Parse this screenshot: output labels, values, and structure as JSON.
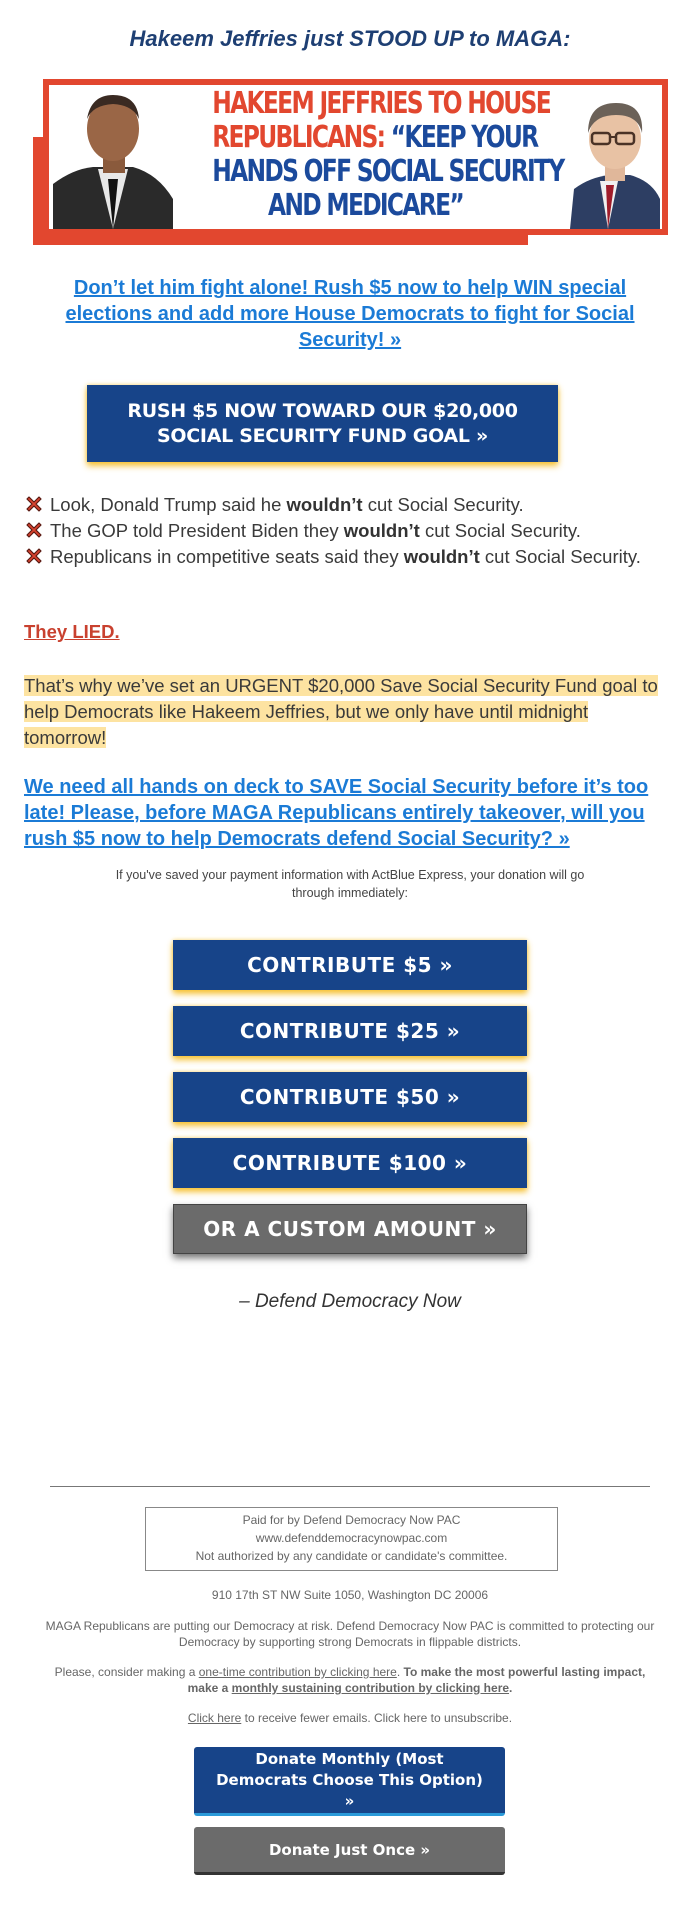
{
  "headline": "Hakeem Jeffries just STOOD UP to MAGA:",
  "banner": {
    "line1": "HAKEEM JEFFRIES TO HOUSE",
    "line2_red": "REPUBLICANS: ",
    "line2_blue": "“KEEP YOUR",
    "line3": "HANDS OFF SOCIAL SECURITY",
    "line4": "AND MEDICARE”",
    "left_photo": "hakeem-jeffries-photo",
    "right_photo": "mike-johnson-photo",
    "colors": {
      "red": "#e2472f",
      "blue": "#1b4a9c"
    }
  },
  "lead_link": "Don’t let him fight alone! Rush $5 now to help WIN special elections and add more House Democrats to fight for Social Security! »",
  "goal_button": "RUSH $5 NOW TOWARD OUR $20,000 SOCIAL SECURITY FUND GOAL »",
  "bullets": [
    {
      "icon": "x-mark-icon",
      "before": "Look, Donald Trump said he ",
      "bold": "wouldn’t",
      "after": " cut Social Security."
    },
    {
      "icon": "x-mark-icon",
      "before": "The GOP told President Biden they ",
      "bold": "wouldn’t",
      "after": " cut Social Security."
    },
    {
      "icon": "x-mark-icon",
      "before": "Republicans in competitive seats said they ",
      "bold": "wouldn’t",
      "after": " cut Social Security."
    }
  ],
  "lied": "They LIED.",
  "urgent_text": "That’s why we’ve set an URGENT $20,000 Save Social Security Fund goal to help Democrats like Hakeem Jeffries, but we only have until midnight tomorrow!",
  "main_link": "We need all hands on deck to SAVE Social Security before it’s too late! Please, before MAGA Republicans entirely takeover, will you rush $5 now to help Democrats defend Social Security? »",
  "express_note": "If you've saved your payment information with ActBlue Express, your donation will go through immediately:",
  "contribute_buttons": [
    {
      "label": "CONTRIBUTE $5 »",
      "amount": 5
    },
    {
      "label": "CONTRIBUTE $25 »",
      "amount": 25
    },
    {
      "label": "CONTRIBUTE $50 »",
      "amount": 50
    },
    {
      "label": "CONTRIBUTE $100 »",
      "amount": 100
    }
  ],
  "custom_button": "OR A CUSTOM AMOUNT »",
  "signoff": "– Defend Democracy Now",
  "footer": {
    "disclaimer": [
      "Paid for by Defend Democracy Now PAC",
      "www.defenddemocracynowpac.com",
      "Not authorized by any candidate or candidate's committee."
    ],
    "address": "910 17th ST NW Suite 1050, Washington DC 20006",
    "mission": "MAGA Republicans are putting our Democracy at risk. Defend Democracy Now PAC is committed to protecting our Democracy by supporting strong Democrats in flippable districts.",
    "consider": {
      "prefix": "Please, consider making a ",
      "one_time_link": "one-time contribution by clicking here",
      "period": ". ",
      "bold_prefix": "To make the most powerful lasting impact, make a ",
      "monthly_link": "monthly sustaining contribution by clicking here",
      "bold_suffix": "."
    },
    "fewer": {
      "link": "Click here",
      "rest": " to receive fewer emails. Click here to unsubscribe."
    },
    "monthly_button": "Donate Monthly (Most Democrats Choose This Option) »",
    "once_button": "Donate Just Once »"
  },
  "colors": {
    "navy": "#174489",
    "link_blue": "#1b7bd6",
    "headline_navy": "#1e3f73",
    "highlight": "#fde3a1",
    "lied_red": "#c9412f",
    "gold_glow": "#f5be28",
    "gray_button": "#6b6b6b"
  }
}
